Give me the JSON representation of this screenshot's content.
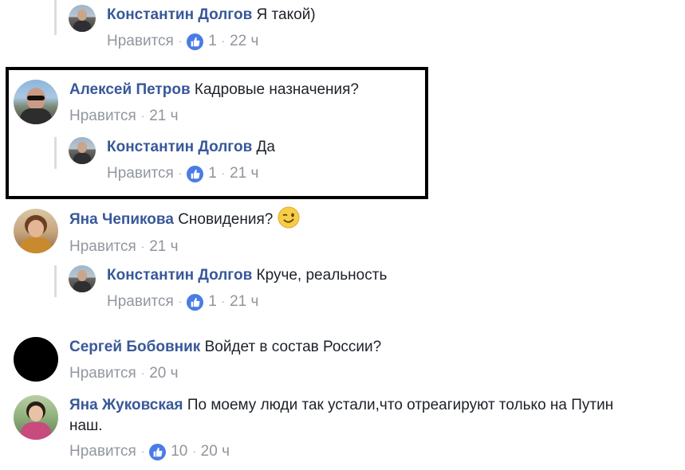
{
  "comments": [
    {
      "author": "Константин Долгов",
      "text": "Я такой)",
      "like_label": "Нравится",
      "reactions": "1",
      "time": "22 ч"
    },
    {
      "author": "Алексей Петров",
      "text": "Кадровые назначения?",
      "like_label": "Нравится",
      "time": "21 ч"
    },
    {
      "author": "Константин Долгов",
      "text": "Да",
      "like_label": "Нравится",
      "reactions": "1",
      "time": "21 ч"
    },
    {
      "author": "Яна Чепикова",
      "text": "Сновидения?",
      "like_label": "Нравится",
      "time": "21 ч"
    },
    {
      "author": "Константин Долгов",
      "text": "Круче, реальность",
      "like_label": "Нравится",
      "reactions": "1",
      "time": "21 ч"
    },
    {
      "author": "Сергей Бобовник",
      "text": "Войдет в состав России?",
      "like_label": "Нравится",
      "time": "20 ч"
    },
    {
      "author": "Яна Жуковская",
      "text": "По моему люди так устали,что отреагируют только на Путин",
      "text_line2": "наш.",
      "like_label": "Нравится",
      "reactions": "10",
      "time": "20 ч"
    }
  ],
  "colors": {
    "author": "#385898",
    "meta": "#90949c",
    "like_badge": "#4a7ce5",
    "highlight_border": "#000000"
  },
  "icons": {
    "reaction": "thumbs-up-icon",
    "emoji": "wink-emoji-icon"
  }
}
